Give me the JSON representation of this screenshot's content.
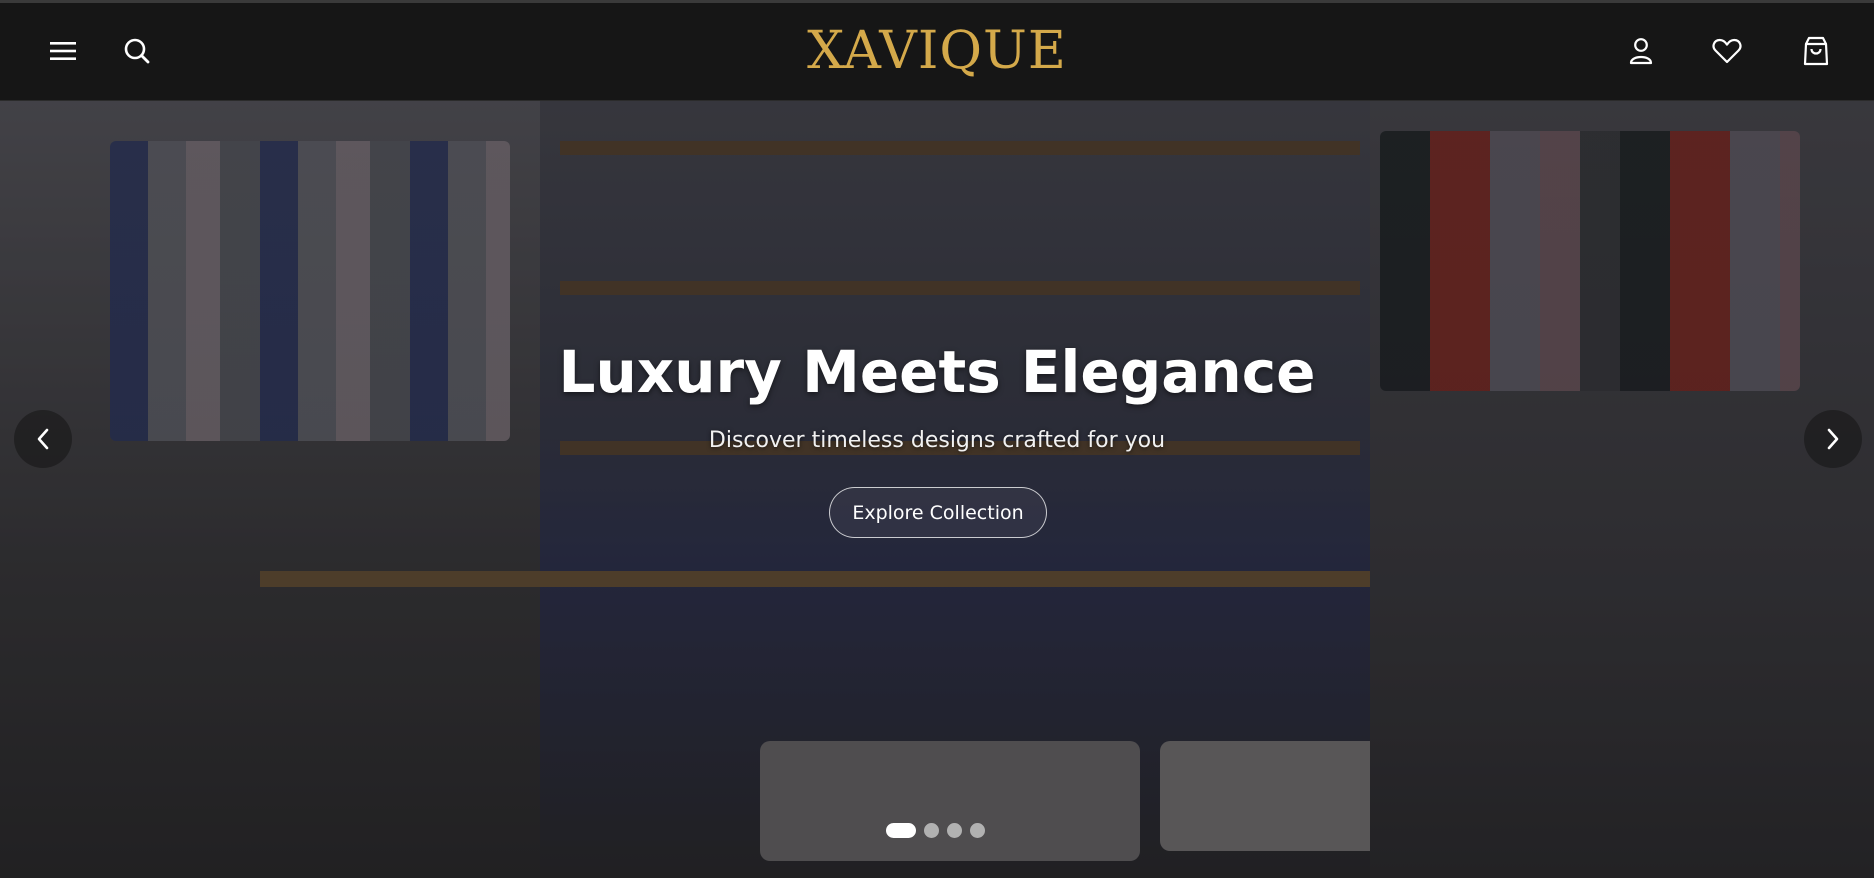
{
  "header": {
    "brand": "XAVIQUE",
    "brand_color": "#d4a94a",
    "left_icons": [
      "menu-icon",
      "search-icon"
    ],
    "right_icons": [
      "user-icon",
      "heart-icon",
      "bag-icon"
    ]
  },
  "hero": {
    "headline": "Luxury Meets Elegance",
    "subheadline": "Discover timeless designs crafted for you",
    "cta_label": "Explore Collection",
    "prev_icon": "chevron-left-icon",
    "next_icon": "chevron-right-icon",
    "slides_total": 4,
    "active_slide": 1
  }
}
